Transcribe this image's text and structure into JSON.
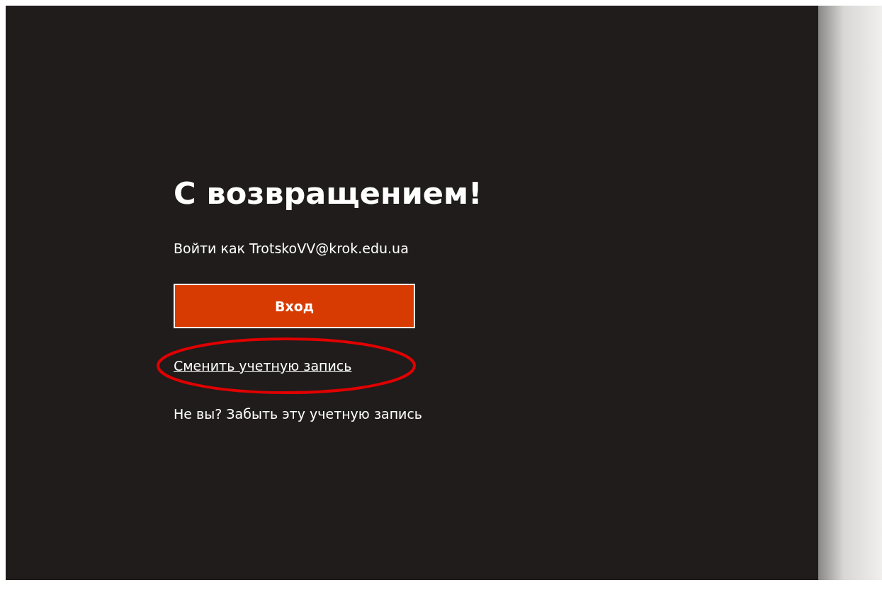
{
  "title": "С возвращением!",
  "signin_as": "Войти как TrotskoVV@krok.edu.ua",
  "signin_button": "Вход",
  "switch_account_link": "Сменить учетную запись",
  "forget_account": "Не вы? Забыть эту учетную запись"
}
